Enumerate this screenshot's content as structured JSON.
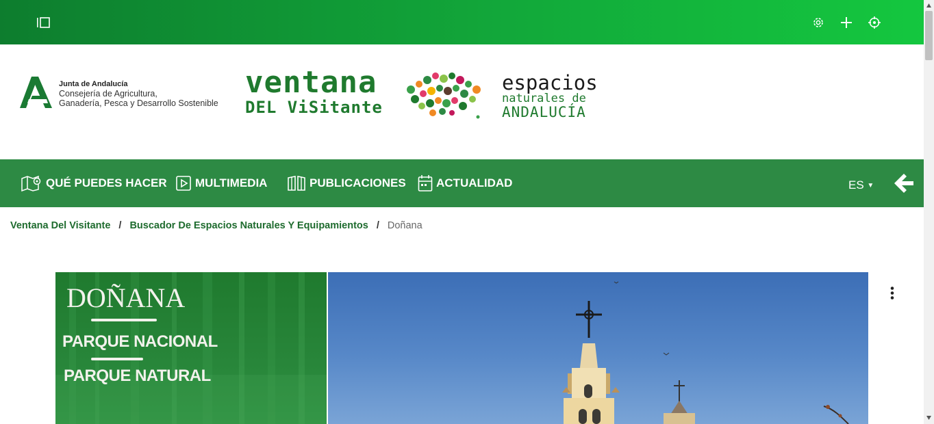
{
  "topbar": {
    "icons": [
      "sidebar-toggle-icon",
      "settings-icon",
      "plus-icon",
      "crosshair-icon"
    ],
    "background_colors": [
      "#0d7d2e",
      "#14c73f"
    ]
  },
  "header": {
    "junta": {
      "name": "Junta de Andalucía",
      "line1": "Consejería de Agricultura,",
      "line2": "Ganadería, Pesca y Desarrollo Sostenible"
    },
    "ventana": {
      "line1": "ventana",
      "line2": "DEL ViSitante"
    },
    "espacios": {
      "line1": "espacios",
      "line2": "naturales de",
      "line3": "ANDALUCÍA"
    },
    "brand_color": "#1f7a2e"
  },
  "nav": {
    "background": "#2d8a44",
    "items": [
      {
        "label": "QUÉ PUEDES HACER",
        "icon": "map-pin-icon"
      },
      {
        "label": "MULTIMEDIA",
        "icon": "play-icon"
      },
      {
        "label": "PUBLICACIONES",
        "icon": "book-icon"
      },
      {
        "label": "ACTUALIDAD",
        "icon": "calendar-icon"
      }
    ],
    "language": "ES",
    "back_icon": "arrow-left-icon"
  },
  "breadcrumb": {
    "items": [
      "Ventana Del Visitante",
      "Buscador De Espacios Naturales Y Equipamientos"
    ],
    "separator": "/",
    "current": "Doñana"
  },
  "hero": {
    "title": "DOÑANA",
    "sub1": "PARQUE NACIONAL",
    "sub2": "PARQUE NATURAL",
    "menu_icon": "kebab-menu-icon"
  }
}
